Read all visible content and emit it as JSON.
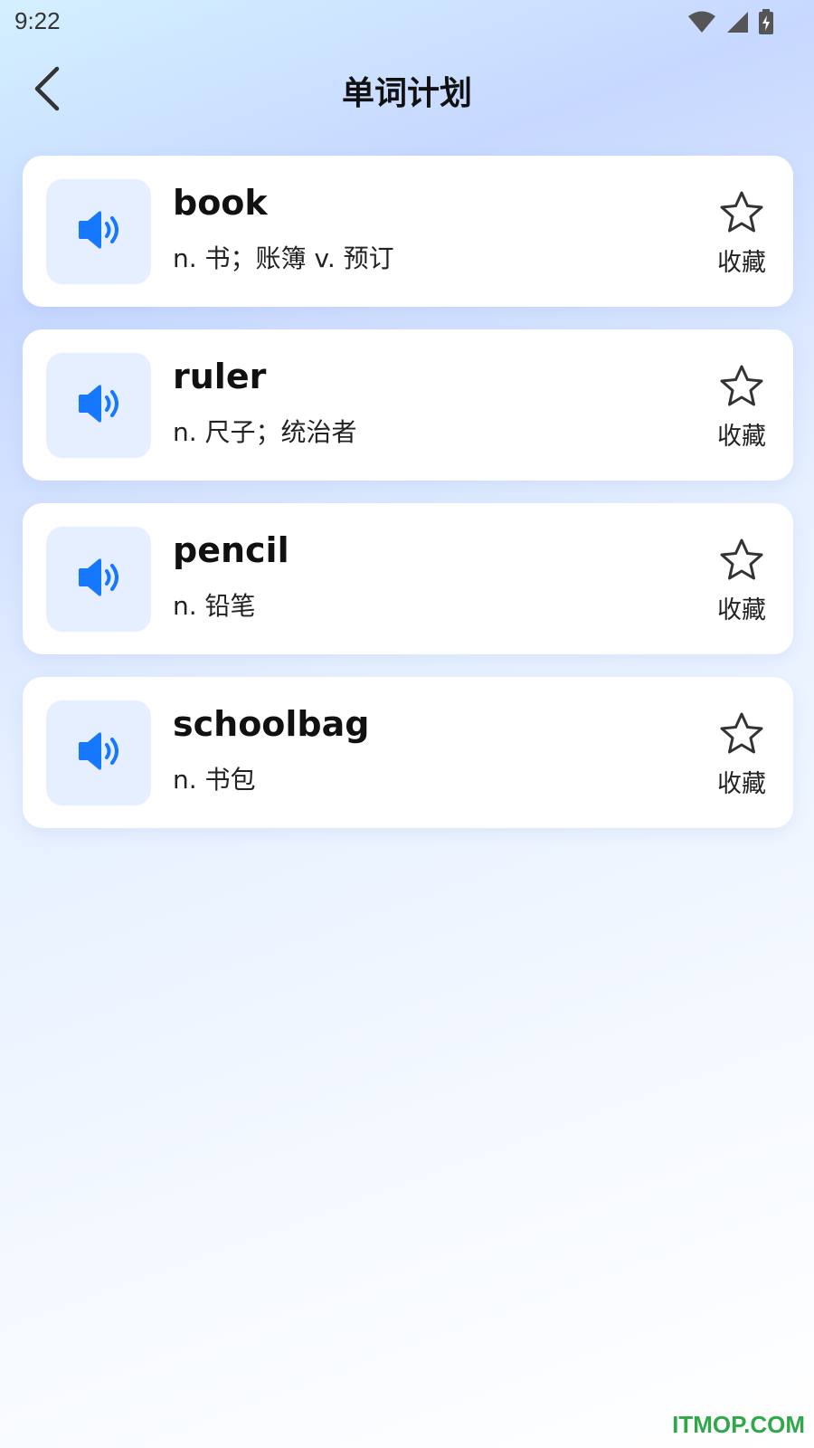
{
  "status_bar": {
    "time": "9:22",
    "icons": [
      "wifi-icon",
      "signal-icon",
      "battery-charging-icon"
    ]
  },
  "header": {
    "title": "单词计划",
    "back_icon": "chevron-left-icon"
  },
  "words": [
    {
      "word": "book",
      "meaning": "n. 书；账簿 v. 预订",
      "fav_label": "收藏"
    },
    {
      "word": "ruler",
      "meaning": "n. 尺子；统治者",
      "fav_label": "收藏"
    },
    {
      "word": "pencil",
      "meaning": "n. 铅笔",
      "fav_label": "收藏"
    },
    {
      "word": "schoolbag",
      "meaning": "n. 书包",
      "fav_label": "收藏"
    }
  ],
  "colors": {
    "accent_blue": "#1677ff",
    "speaker_bg": "#e6efff",
    "watermark_green": "#2fa84a"
  },
  "watermark": "ITMOP.COM"
}
